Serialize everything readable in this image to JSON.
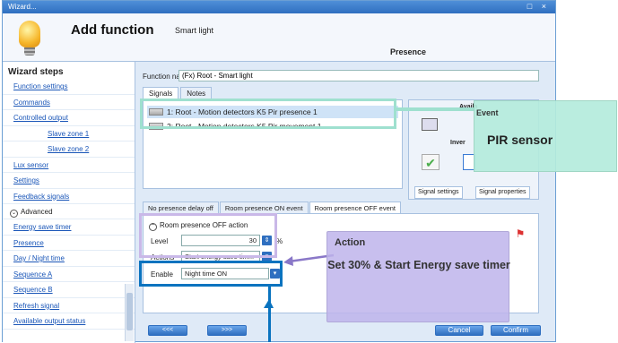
{
  "window": {
    "title": "Wizard...",
    "controls": "□ ×"
  },
  "header": {
    "title": "Add function",
    "subtitle": "Smart light",
    "section": "Presence"
  },
  "sidebar": {
    "heading": "Wizard steps",
    "items": [
      {
        "label": "Function settings"
      },
      {
        "label": "Commands"
      },
      {
        "label": "Controlled output"
      },
      {
        "label": "Slave zone 1"
      },
      {
        "label": "Slave zone 2"
      },
      {
        "label": "Lux sensor"
      },
      {
        "label": "Settings"
      },
      {
        "label": "Feedback signals"
      }
    ],
    "advanced": "Advanced",
    "adv_items": [
      {
        "label": "Energy save timer"
      },
      {
        "label": "Presence"
      },
      {
        "label": "Day / Night time"
      },
      {
        "label": "Sequence A"
      },
      {
        "label": "Sequence B"
      },
      {
        "label": "Refresh signal"
      },
      {
        "label": "Available output status"
      }
    ]
  },
  "function": {
    "name_label": "Function name:",
    "name_value": "(Fx) Root - Smart light"
  },
  "tabs1": [
    "Signals",
    "Notes"
  ],
  "signals": [
    "1: Root - Motion detectors K5 Pir presence 1",
    "2: Root - Motion detectors K5 Pir movement 1"
  ],
  "props": {
    "available": "Availa",
    "inverted": "Inver",
    "tab_settings": "Signal settings",
    "tab_properties": "Signal properties"
  },
  "tabs2": [
    "No presence delay off",
    "Room presence ON event",
    "Room presence OFF event"
  ],
  "panel2": {
    "head": "Room presence OFF action",
    "level_label": "Level",
    "level_value": "30",
    "level_unit": "%",
    "actions_label": "Actions",
    "actions_value": "Start energy save tim...",
    "enable_label": "Enable",
    "enable_value": "Night time ON"
  },
  "buttons": {
    "prev": "<<<",
    "next": ">>>",
    "cancel": "Cancel",
    "confirm": "Confirm"
  },
  "callouts": {
    "pir_event": "Event",
    "pir_text": "PIR sensor",
    "action_title": "Action",
    "action_text": "Set 30% & Start Energy save timer"
  }
}
